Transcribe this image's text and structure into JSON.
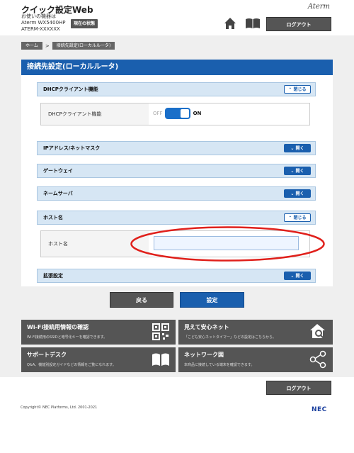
{
  "header": {
    "app_title": "クイック設定Web",
    "device_line1": "お使いの機器は",
    "device_line2": "Aterm  WX5400HP",
    "device_line3": "ATERM-XXXXXX",
    "status_button": "現在の状態",
    "brand": "Aterm",
    "logout": "ログアウト"
  },
  "breadcrumb": {
    "home": "ホーム",
    "separator": ">",
    "current": "接続先設定(ローカルルータ)"
  },
  "page_title": "接続先設定(ローカルルータ)",
  "sections": {
    "dhcp": {
      "title": "DHCPクライアント機能",
      "button": "閉じる",
      "row_label": "DHCPクライアント機能",
      "toggle_off": "OFF",
      "toggle_on": "ON",
      "toggle_state": "on"
    },
    "ip": {
      "title": "IPアドレス/ネットマスク",
      "button": "開く"
    },
    "gateway": {
      "title": "ゲートウェイ",
      "button": "開く"
    },
    "nameserver": {
      "title": "ネームサーバ",
      "button": "開く"
    },
    "hostname": {
      "title": "ホスト名",
      "button": "閉じる",
      "row_label": "ホスト名",
      "value": ""
    },
    "advanced": {
      "title": "拡張設定",
      "button": "開く"
    }
  },
  "actions": {
    "back": "戻る",
    "set": "設定"
  },
  "tiles": [
    {
      "title": "Wi-Fi接続用情報の確認",
      "desc": "Wi-Fi接続用のSSIDと暗号化キーを確認できます。",
      "icon": "qr-code-icon"
    },
    {
      "title": "見えて安心ネット",
      "desc": "「こども安心ネットタイマー」などの設定はこちらから。",
      "icon": "house-search-icon"
    },
    {
      "title": "サポートデスク",
      "desc": "Q&A、機能別設定ガイドなどの情報をご覧になれます。",
      "icon": "open-book-icon"
    },
    {
      "title": "ネットワーク図",
      "desc": "本商品に接続している端末を確認できます。",
      "icon": "share-nodes-icon"
    }
  ],
  "footer": {
    "logout": "ログアウト",
    "copyright": "Copyright© NEC Platforms, Ltd. 2001-2021",
    "logo": "NEC"
  },
  "colors": {
    "primary": "#1a5fae",
    "button_dark": "#555555",
    "section_bg": "#d6e6f4",
    "annotation": "#e0201b"
  }
}
